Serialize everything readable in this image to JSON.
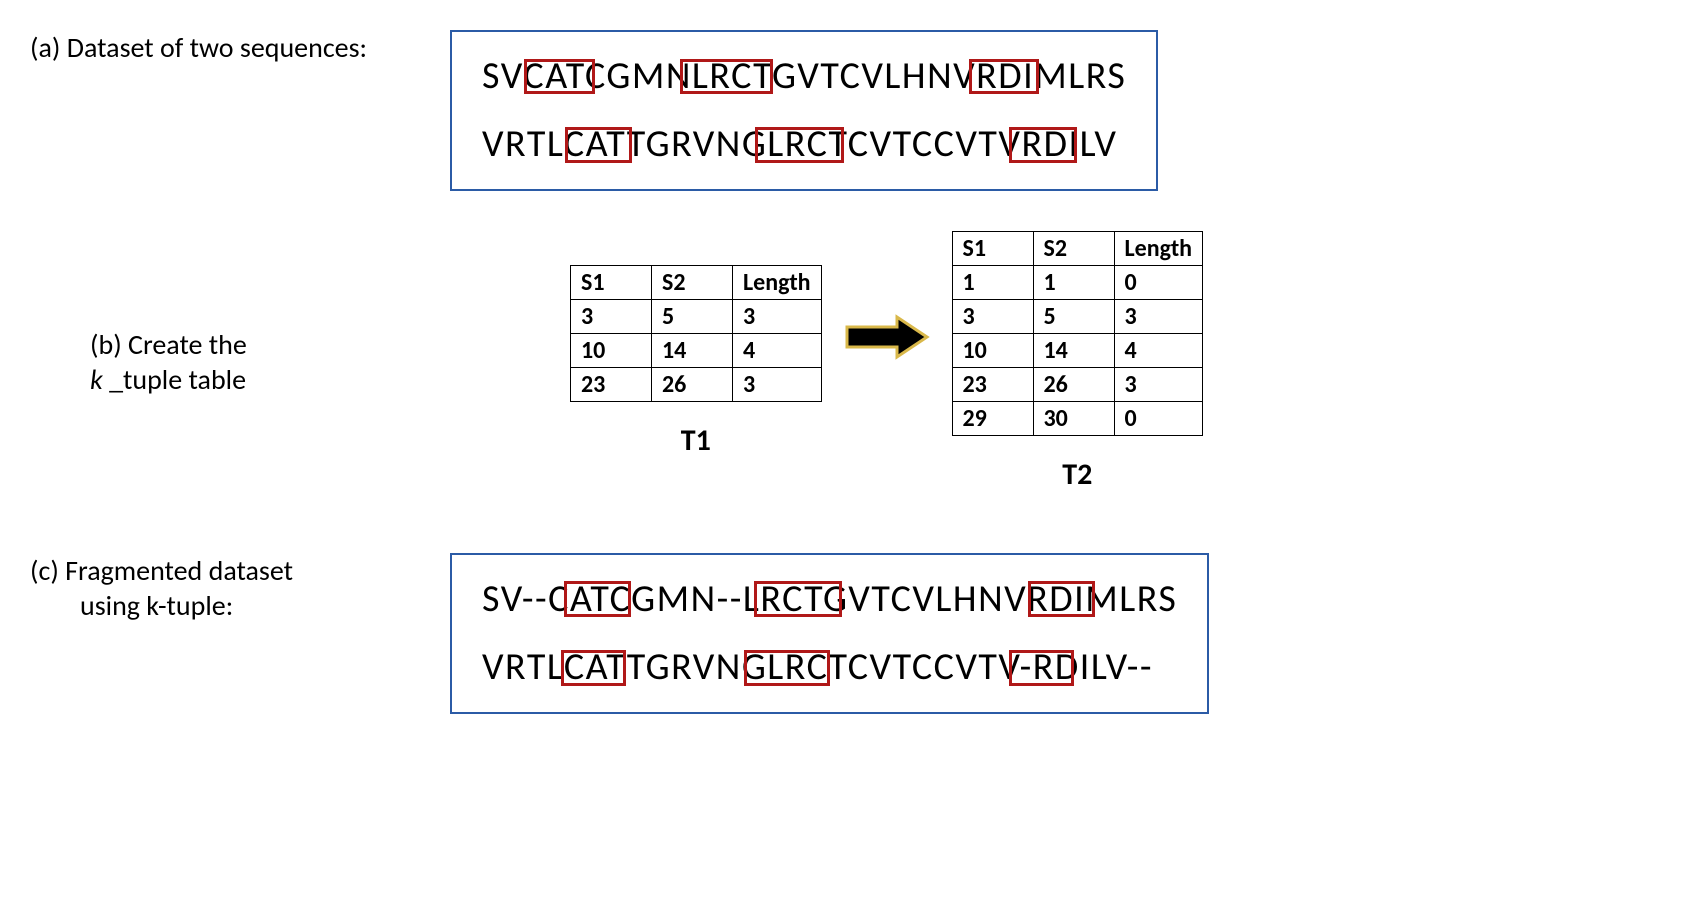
{
  "sectionA": {
    "label_prefix": "(a) ",
    "label": "Dataset of two sequences:",
    "seq1": "SVCATCGMNLRCTGVTCVLHNVRDIMLRS",
    "seq2": "VRTLCATTGRVNGLRCTCVTCCVTVRDILV",
    "highlights": {
      "seq1": [
        {
          "start": 2,
          "len": 3
        },
        {
          "start": 9,
          "len": 4
        },
        {
          "start": 22,
          "len": 3
        }
      ],
      "seq2": [
        {
          "start": 4,
          "len": 3
        },
        {
          "start": 13,
          "len": 4
        },
        {
          "start": 25,
          "len": 3
        }
      ]
    }
  },
  "sectionB": {
    "label_prefix": "(b) ",
    "label_line1": "Create the",
    "label_line2_k": "k",
    "label_line2_rest": " _tuple table",
    "t1": {
      "name": "T1",
      "headers": [
        "S1",
        "S2",
        "Length"
      ],
      "rows": [
        [
          "3",
          "5",
          "3"
        ],
        [
          "10",
          "14",
          "4"
        ],
        [
          "23",
          "26",
          "3"
        ]
      ]
    },
    "t2": {
      "name": "T2",
      "headers": [
        "S1",
        "S2",
        "Length"
      ],
      "rows": [
        [
          "1",
          "1",
          "0"
        ],
        [
          "3",
          "5",
          "3"
        ],
        [
          "10",
          "14",
          "4"
        ],
        [
          "23",
          "26",
          "3"
        ],
        [
          "29",
          "30",
          "0"
        ]
      ]
    }
  },
  "sectionC": {
    "label_prefix": "(c) ",
    "label_line1": "Fragmented dataset",
    "label_line2": "using k-tuple:",
    "seq1": "SV--CATCGMN--LRCTGVTCVLHNVRDIMLRS",
    "seq2": "VRTLCATTGRVNGLRCTCVTCCVTV-RDILV--",
    "highlights": {
      "seq1": [
        {
          "start": 4,
          "len": 3
        },
        {
          "start": 13,
          "len": 4
        },
        {
          "start": 26,
          "len": 3
        }
      ],
      "seq2": [
        {
          "start": 4,
          "len": 3
        },
        {
          "start": 13,
          "len": 4
        },
        {
          "start": 26,
          "len": 3
        }
      ]
    }
  }
}
